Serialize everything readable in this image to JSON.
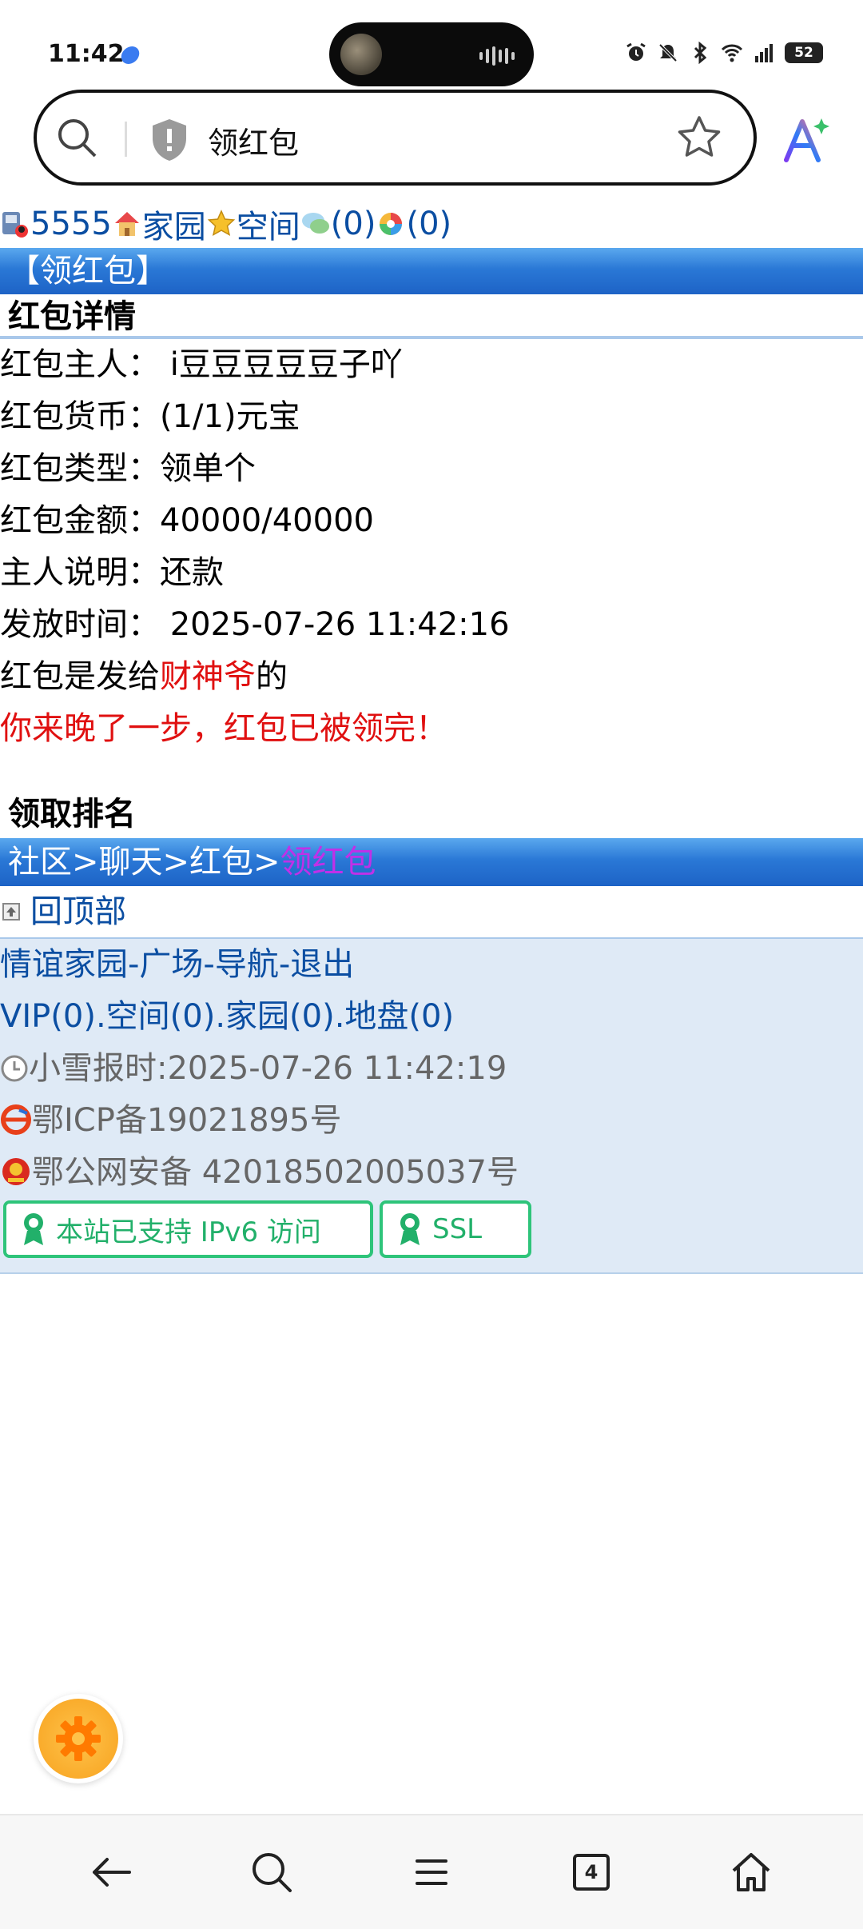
{
  "status_bar": {
    "time": "11:42",
    "battery": "52"
  },
  "address_bar": {
    "query": "领红包"
  },
  "top_links": {
    "user_id": "5555",
    "home": "家园",
    "space": "空间",
    "messages": "(0)",
    "other": "(0)"
  },
  "header_bar": {
    "title": "【领红包】"
  },
  "details": {
    "title": "红包详情",
    "owner": "红包主人：  i豆豆豆豆豆子吖",
    "currency": "红包货币：(1/1)元宝",
    "type": "红包类型：领单个",
    "amount": "红包金额：40000/40000",
    "note": "主人说明：还款",
    "time": "发放时间：  2025-07-26 11:42:16",
    "recipient_prefix": "红包是发给",
    "recipient_name": "财神爷",
    "recipient_suffix": "的",
    "message": "你来晚了一步，红包已被领完！"
  },
  "ranking": {
    "title": "领取排名"
  },
  "breadcrumb": {
    "path": "社区>聊天>红包>",
    "current": "领红包"
  },
  "back_to_top": "回顶部",
  "footer": {
    "links": "情谊家园-广场-导航-退出",
    "counts": "VIP(0).空间(0).家园(0).地盘(0)",
    "time": "小雪报时:2025-07-26 11:42:19",
    "icp": "鄂ICP备19021895号",
    "police": "鄂公网安备 42018502005037号",
    "badge_ipv6": "本站已支持 IPv6 访问",
    "badge_ssl": "SSL"
  },
  "nav": {
    "tabs_count": "4"
  },
  "colors": {
    "accent_blue": "#2a78d6",
    "link": "#0b4ea2",
    "red": "#e01010",
    "badge_green": "#2ec47a"
  }
}
